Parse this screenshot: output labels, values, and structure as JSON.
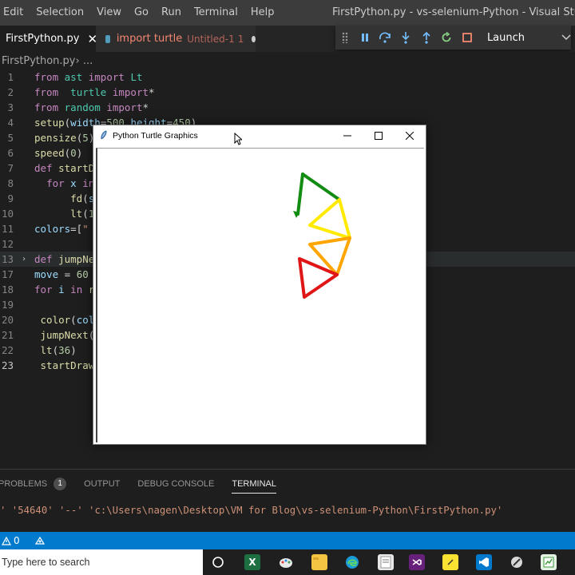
{
  "menu": {
    "items": [
      "Edit",
      "Selection",
      "View",
      "Go",
      "Run",
      "Terminal",
      "Help"
    ],
    "window_title": "FirstPython.py - vs-selenium-Python - Visual Studio Code"
  },
  "tabs": {
    "active_label": "FirstPython.py",
    "active_close": "✕",
    "inactive_label": "import turtle",
    "inactive_sub": "Untitled-1",
    "inactive_count": "1"
  },
  "debug": {
    "launch_label": "Launch",
    "chevron": "⌄"
  },
  "breadcrumb": {
    "file": "FirstPython.py",
    "sep": " › ..."
  },
  "editor": {
    "lines": [
      {
        "n": "1",
        "html": "<span class='kw'>from</span> <span class='mod'>ast</span> <span class='kw'>import</span> <span class='mod'>Lt</span>"
      },
      {
        "n": "2",
        "html": "<span class='kw'>from</span>  <span class='mod'>turtle</span> <span class='kw'>import</span>*"
      },
      {
        "n": "3",
        "html": "<span class='kw'>from</span> <span class='mod'>random</span> <span class='kw'>import</span>*"
      },
      {
        "n": "4",
        "html": "<span class='fn'>setup</span>(<span class='var'>width</span>=<span class='num'>500</span>,<span class='var'>height</span>=<span class='num'>450</span>)"
      },
      {
        "n": "5",
        "html": "<span class='fn'>pensize</span>(<span class='num'>5</span>)"
      },
      {
        "n": "6",
        "html": "<span class='fn'>speed</span>(<span class='num'>0</span>)"
      },
      {
        "n": "7",
        "html": "<span class='kw'>def</span> <span class='fn'>startD</span>"
      },
      {
        "n": "8",
        "html": "  <span class='kw'>for</span> <span class='var'>x</span> <span class='kw'>in</span>"
      },
      {
        "n": "9",
        "html": "      <span class='fn'>fd</span>(<span class='var'>s</span>"
      },
      {
        "n": "10",
        "html": "      <span class='fn'>lt</span>(<span class='num'>1</span>"
      },
      {
        "n": "11",
        "html": "<span class='var'>colors</span>=[<span class='str'>\"</span>"
      },
      {
        "n": "12",
        "html": ""
      },
      {
        "n": "13",
        "html": "<span class='kw'>def</span> <span class='fn'>jumpNe</span>",
        "fold": "›",
        "hl": true
      },
      {
        "n": "17",
        "html": "<span class='var'>move</span> = <span class='num'>60</span>"
      },
      {
        "n": "18",
        "html": "<span class='kw'>for</span> <span class='var'>i</span> <span class='kw'>in</span> <span class='fn'>r</span>"
      },
      {
        "n": "19",
        "html": ""
      },
      {
        "n": "20",
        "html": " <span class='fn'>color</span>(<span class='var'>col</span>"
      },
      {
        "n": "21",
        "html": " <span class='fn'>jumpNext</span>("
      },
      {
        "n": "22",
        "html": " <span class='fn'>lt</span>(<span class='num'>36</span>)"
      },
      {
        "n": "23",
        "html": " <span class='fn'>startDraw</span>",
        "cur": true
      }
    ]
  },
  "turtle": {
    "title": "Python Turtle Graphics",
    "minimize": "—",
    "maximize": "☐",
    "close": "✕",
    "colors": {
      "green": "#128c12",
      "yellow": "#ffea00",
      "orange": "#ffa500",
      "red": "#e01515"
    }
  },
  "panel": {
    "tabs": [
      "PROBLEMS",
      "OUTPUT",
      "DEBUG CONSOLE",
      "TERMINAL"
    ],
    "problems_count": "1",
    "active_tab": "TERMINAL",
    "terminal_line": "' '54640' '--' 'c:\\Users\\nagen\\Desktop\\VM for Blog\\vs-selenium-Python\\FirstPython.py'"
  },
  "status": {
    "warnings": "0"
  },
  "taskbar": {
    "search_placeholder": "Type here to search"
  },
  "colors": {
    "accent": "#007acc",
    "editor_bg": "#1e1e1e"
  }
}
